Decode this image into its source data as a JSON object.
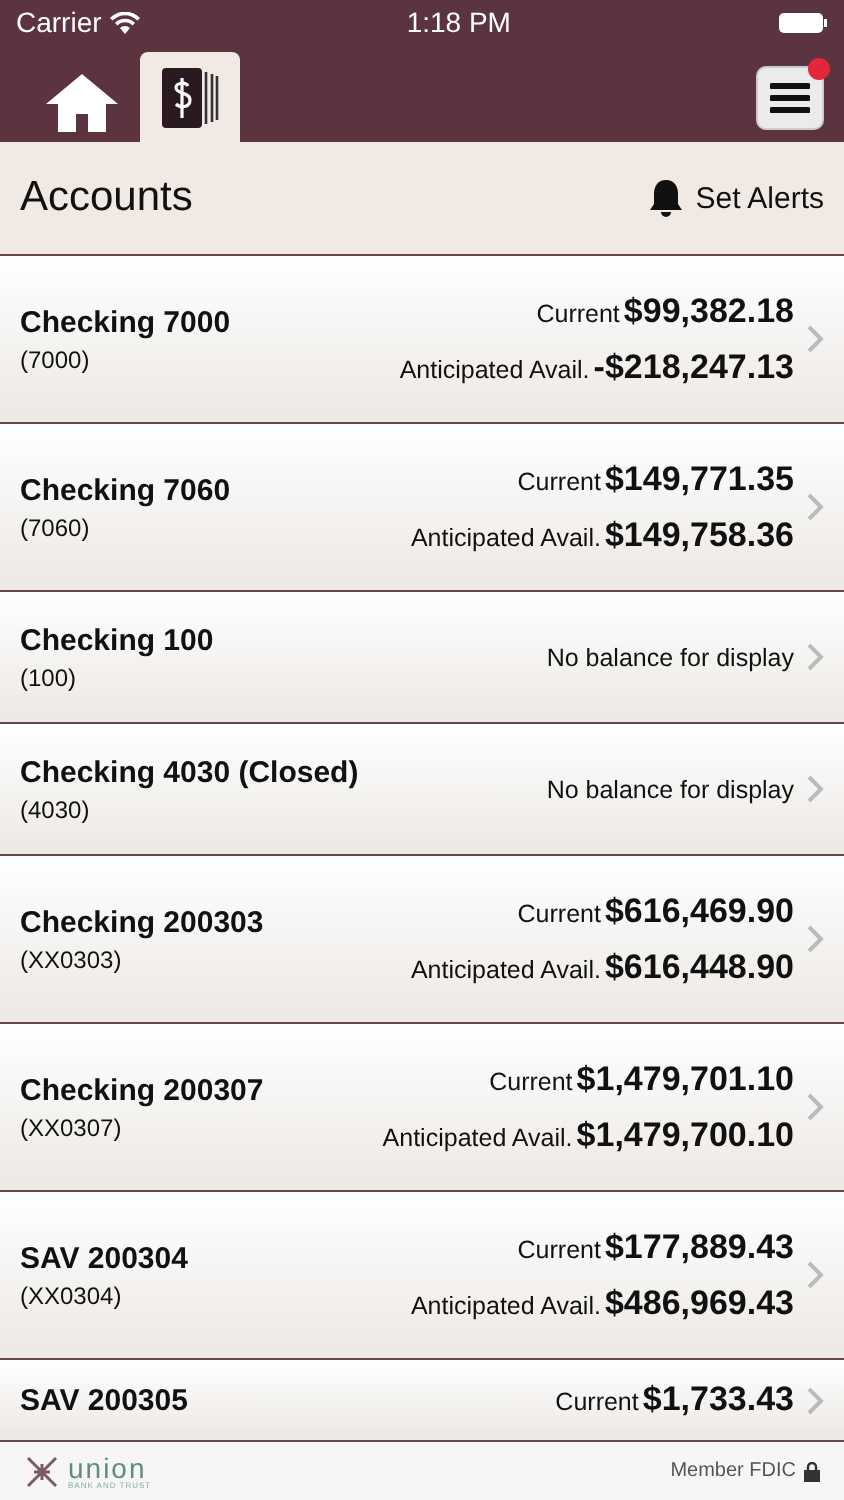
{
  "status_bar": {
    "carrier": "Carrier",
    "time": "1:18 PM"
  },
  "nav": {
    "tabs": [
      {
        "kind": "home",
        "selected": false
      },
      {
        "kind": "accounts",
        "selected": true
      }
    ],
    "menu_badge": true
  },
  "title_bar": {
    "title": "Accounts",
    "action": "Set Alerts"
  },
  "accounts": [
    {
      "name": "Checking 7000",
      "number": "(7000)",
      "kind": "balances",
      "balances": [
        {
          "label": "Current",
          "amount": "$99,382.18"
        },
        {
          "label": "Anticipated Avail.",
          "amount": "-$218,247.13"
        }
      ]
    },
    {
      "name": "Checking 7060",
      "number": "(7060)",
      "kind": "balances",
      "balances": [
        {
          "label": "Current",
          "amount": "$149,771.35"
        },
        {
          "label": "Anticipated Avail.",
          "amount": "$149,758.36"
        }
      ]
    },
    {
      "name": "Checking 100",
      "number": "(100)",
      "kind": "message",
      "message": "No balance for display"
    },
    {
      "name": "Checking 4030 (Closed)",
      "number": "(4030)",
      "kind": "message",
      "message": "No balance for display"
    },
    {
      "name": "Checking 200303",
      "number": "(XX0303)",
      "kind": "balances",
      "balances": [
        {
          "label": "Current",
          "amount": "$616,469.90"
        },
        {
          "label": "Anticipated Avail.",
          "amount": "$616,448.90"
        }
      ]
    },
    {
      "name": "Checking 200307",
      "number": "(XX0307)",
      "kind": "balances",
      "balances": [
        {
          "label": "Current",
          "amount": "$1,479,701.10"
        },
        {
          "label": "Anticipated Avail.",
          "amount": "$1,479,700.10"
        }
      ]
    },
    {
      "name": "SAV 200304",
      "number": "(XX0304)",
      "kind": "balances",
      "balances": [
        {
          "label": "Current",
          "amount": "$177,889.43"
        },
        {
          "label": "Anticipated Avail.",
          "amount": "$486,969.43"
        }
      ]
    },
    {
      "name": "SAV 200305",
      "kind": "balances",
      "balances": [
        {
          "label": "Current",
          "amount": "$1,733.43"
        }
      ]
    }
  ],
  "footer": {
    "logo": "union",
    "logo_tagline": "BANK AND TRUST",
    "member": "Member FDIC"
  }
}
